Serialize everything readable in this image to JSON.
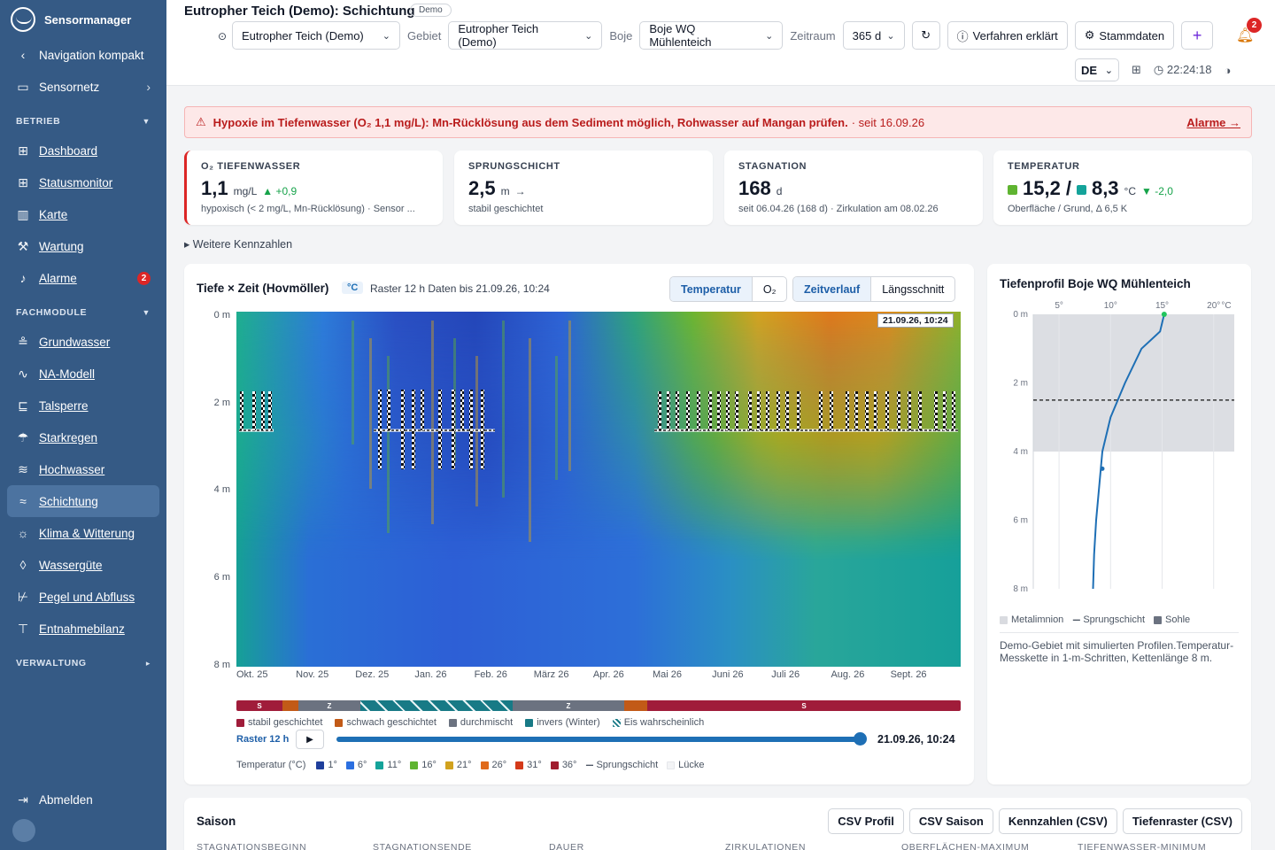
{
  "sidebar": {
    "brand": "Sensormanager",
    "nav_compact": "Navigation kompakt",
    "sensornetz": "Sensornetz",
    "section_betrieb": "BETRIEB",
    "betrieb": [
      "Dashboard",
      "Statusmonitor",
      "Karte",
      "Wartung",
      "Alarme"
    ],
    "alarm_badge": "2",
    "section_fachmodule": "FACHMODULE",
    "fachmodule": [
      "Grundwasser",
      "NA-Modell",
      "Talsperre",
      "Starkregen",
      "Hochwasser",
      "Schichtung",
      "Klima & Witterung",
      "Wassergüte",
      "Pegel und Abfluss",
      "Entnahmebilanz"
    ],
    "section_verwaltung": "VERWALTUNG",
    "logout": "Abmelden"
  },
  "header": {
    "title": "Eutropher Teich (Demo): Schichtung",
    "chip": "Demo",
    "location_value": "Eutropher Teich (Demo)",
    "gebiet_label": "Gebiet",
    "gebiet_value": "Eutropher Teich (Demo)",
    "boje_label": "Boje",
    "boje_value": "Boje WQ Mühlenteich",
    "zeitraum_label": "Zeitraum",
    "zeitraum_value": "365 d",
    "verfahren": "Verfahren erklärt",
    "stammdaten": "Stammdaten",
    "bell_count": "2",
    "lang": "DE",
    "clock": "22:24:18"
  },
  "alert": {
    "text": "Hypoxie im Tiefenwasser (O₂ 1,1 mg/L): Mn-Rücklösung aus dem Sediment möglich, Rohwasser auf Mangan prüfen.",
    "since": "· seit 16.09.26",
    "link": "Alarme →"
  },
  "kpis": [
    {
      "title": "O₂ TIEFENWASSER",
      "value": "1,1",
      "unit": "mg/L",
      "delta": "▲ +0,9",
      "sub": "hypoxisch (< 2 mg/L, Mn-Rücklösung) · Sensor ..."
    },
    {
      "title": "SPRUNGSCHICHT",
      "value": "2,5",
      "unit": "m",
      "trend": "→",
      "sub": "stabil geschichtet"
    },
    {
      "title": "STAGNATION",
      "value": "168",
      "unit": "d",
      "sub": "seit 06.04.26 (168 d) · Zirkulation am 08.02.26"
    },
    {
      "title": "TEMPERATUR",
      "value_top": "15,2",
      "sep": "/",
      "value_bottom": "8,3",
      "unit": "°C",
      "delta": "▼ -2,0",
      "sub": "Oberfläche / Grund, Δ 6,5 K"
    }
  ],
  "more_kpis": "▸ Weitere Kennzahlen",
  "hovmoeller": {
    "title": "Tiefe × Zeit (Hovmöller)",
    "unit": "°C",
    "meta": "Raster 12 h   Daten bis 21.09.26, 10:24",
    "tabs_var": [
      "Temperatur",
      "O₂"
    ],
    "tabs_view": [
      "Zeitverlauf",
      "Längsschnitt"
    ],
    "stamp": "21.09.26, 10:24",
    "raster": "Raster 12 h",
    "slider_time": "21.09.26, 10:24",
    "strat_labels": {
      "s": "S",
      "z": "Z"
    },
    "strat_legend": [
      "stabil geschichtet",
      "schwach geschichtet",
      "durchmischt",
      "invers (Winter)",
      "Eis wahrscheinlich"
    ],
    "temp_legend_title": "Temperatur (°C)",
    "temp_legend": [
      "1°",
      "6°",
      "11°",
      "16°",
      "21°",
      "26°",
      "31°",
      "36°"
    ],
    "sprungschicht": "Sprungschicht",
    "luecke": "Lücke"
  },
  "chart_data": [
    {
      "type": "heatmap",
      "title": "Tiefe × Zeit (Hovmöller)",
      "ylabel": "Tiefe",
      "y_ticks": [
        "0 m",
        "2 m",
        "4 m",
        "6 m",
        "8 m"
      ],
      "x_ticks": [
        "Okt. 25",
        "Nov. 25",
        "Dez. 25",
        "Jan. 26",
        "Feb. 26",
        "März 26",
        "Apr. 26",
        "Mai 26",
        "Juni 26",
        "Juli 26",
        "Aug. 26",
        "Sept. 26"
      ],
      "ylim": [
        0,
        8
      ],
      "colorscale": [
        "#1f3f9c",
        "#2b5fd6",
        "#14a39a",
        "#5fb431",
        "#d1a21e",
        "#e06a1a",
        "#d43a1a",
        "#a01c2e"
      ],
      "colorscale_values": [
        1,
        6,
        11,
        16,
        21,
        26,
        31,
        36
      ],
      "thermocline_depth_m": 2.5
    },
    {
      "type": "line",
      "title": "Tiefenprofil Boje WQ Mühlenteich",
      "x_ticks": [
        "5°",
        "10°",
        "15°",
        "20°"
      ],
      "x_unit": "°C",
      "xlim": [
        2.5,
        22
      ],
      "y_ticks": [
        "0 m",
        "2 m",
        "4 m",
        "6 m",
        "8 m"
      ],
      "ylim": [
        0,
        8
      ],
      "series": [
        {
          "x": [
            15.2,
            14.8,
            13.0,
            11.4,
            10.0,
            9.2,
            8.9,
            8.6,
            8.4,
            8.3
          ],
          "y": [
            0,
            0.5,
            1.0,
            2.0,
            3.0,
            4.0,
            5.0,
            6.0,
            7.0,
            8.0
          ]
        }
      ],
      "sprungschicht_m": 2.5,
      "metalimnion_m": [
        0,
        4
      ]
    }
  ],
  "profile": {
    "title": "Tiefenprofil Boje WQ Mühlenteich",
    "legend": [
      "Metalimnion",
      "Sprungschicht",
      "Sohle"
    ],
    "note": "Demo-Gebiet mit simulierten Profilen.Temperatur-Messkette in 1-m-Schritten, Kettenlänge 8 m."
  },
  "season": {
    "title": "Saison",
    "buttons": [
      "CSV Profil",
      "CSV Saison",
      "Kennzahlen (CSV)",
      "Tiefenraster (CSV)"
    ],
    "columns": [
      "STAGNATIONSBEGINN",
      "STAGNATIONSENDE",
      "DAUER",
      "ZIRKULATIONEN",
      "OBERFLÄCHEN-MAXIMUM",
      "TIEFENWASSER-MINIMUM"
    ]
  }
}
